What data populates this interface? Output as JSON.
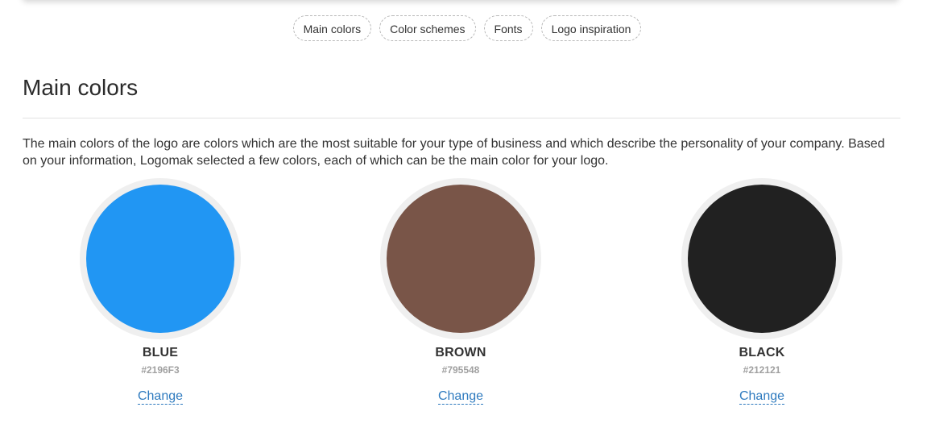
{
  "nav": {
    "pills": [
      {
        "label": "Main colors"
      },
      {
        "label": "Color schemes"
      },
      {
        "label": "Fonts"
      },
      {
        "label": "Logo inspiration"
      }
    ]
  },
  "section": {
    "title": "Main colors",
    "description": "The main colors of the logo are colors which are the most suitable for your type of business and which describe the personality of your company. Based on your information, Logomak selected a few colors, each of which can be the main color for your logo."
  },
  "swatches": [
    {
      "name": "BLUE",
      "hex": "#2196F3",
      "change_label": "Change"
    },
    {
      "name": "BROWN",
      "hex": "#795548",
      "change_label": "Change"
    },
    {
      "name": "BLACK",
      "hex": "#212121",
      "change_label": "Change"
    }
  ]
}
